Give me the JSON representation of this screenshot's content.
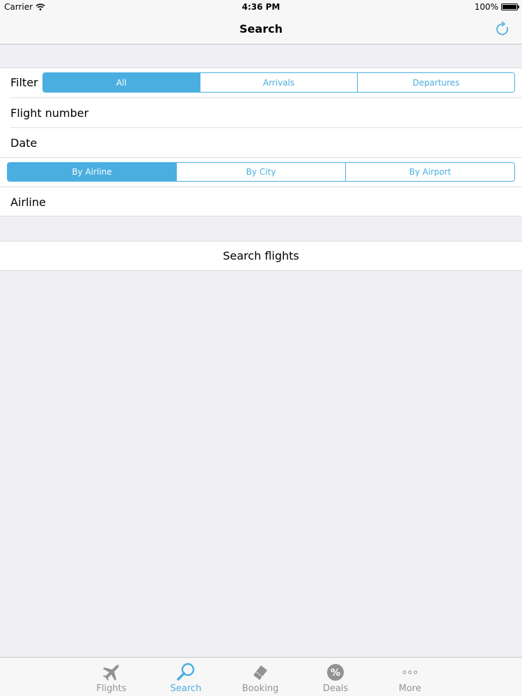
{
  "status_bar": {
    "carrier": "Carrier",
    "time": "4:36 PM",
    "battery": "100%"
  },
  "nav": {
    "title": "Search",
    "refresh_icon": "refresh-icon"
  },
  "filter": {
    "label": "Filter",
    "options": [
      "All",
      "Arrivals",
      "Departures"
    ],
    "selected": "All"
  },
  "fields": {
    "flight_number": "Flight number",
    "date": "Date"
  },
  "lookup": {
    "options": [
      "By Airline",
      "By City",
      "By Airport"
    ],
    "selected": "By Airline"
  },
  "airline_label": "Airline",
  "search_button": "Search flights",
  "tabs": [
    {
      "label": "Flights",
      "icon": "airplane-icon"
    },
    {
      "label": "Search",
      "icon": "search-icon"
    },
    {
      "label": "Booking",
      "icon": "ticket-icon"
    },
    {
      "label": "Deals",
      "icon": "percent-badge-icon"
    },
    {
      "label": "More",
      "icon": "more-dots-icon"
    }
  ],
  "colors": {
    "accent": "#4aaee0",
    "inactive": "#929292",
    "background": "#efeff4"
  }
}
